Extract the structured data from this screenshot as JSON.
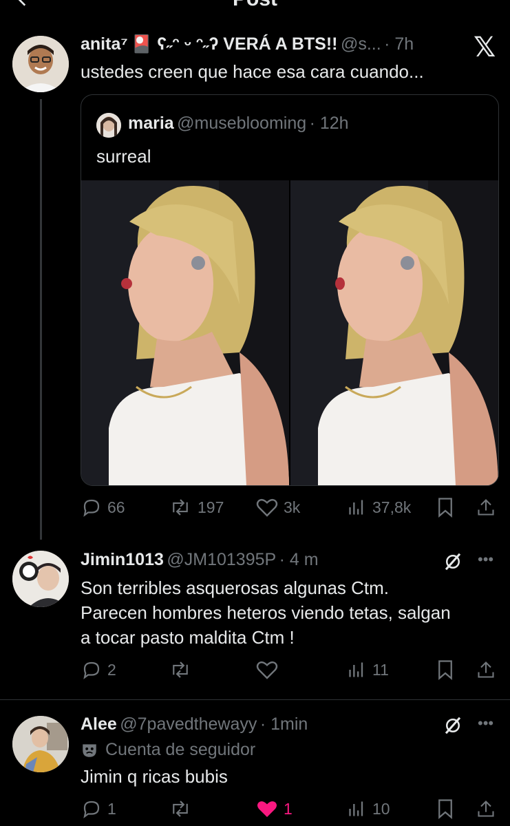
{
  "header": {
    "title": "Post"
  },
  "main_post": {
    "author_name": "anita⁷",
    "author_badges": "🎴 ʕ˶ᵔ ᵕ ᵔ˶ʔ VERÁ A BTS!!",
    "handle": "@s...",
    "time": "· 7h",
    "text": "ustedes creen que hace esa cara cuando...",
    "quote": {
      "author_name": "maria",
      "handle": "@museblooming",
      "time": "· 12h",
      "text": "surreal"
    },
    "stats": {
      "replies": "66",
      "reposts": "197",
      "likes": "3k",
      "views": "37,8k"
    }
  },
  "replies": [
    {
      "author_name": "Jimin1013",
      "handle": "@JM101395P",
      "time": "· 4 m",
      "text_lines": [
        "Son terribles asquerosas algunas Ctm.",
        "Parecen hombres heteros viendo tetas, salgan",
        "a tocar pasto maldita Ctm !"
      ],
      "stats": {
        "replies": "2",
        "reposts": "",
        "likes": "",
        "views": "11"
      }
    },
    {
      "author_name": "Alee",
      "handle": "@7pavedthewayy",
      "time": "· 1min",
      "follower_label": "Cuenta de seguidor",
      "text": "Jimin q ricas bubis",
      "stats": {
        "replies": "1",
        "reposts": "",
        "likes": "1",
        "views": "10"
      }
    }
  ],
  "colors": {
    "background": "#000000",
    "text": "#e7e9ea",
    "secondary": "#71767b",
    "like": "#f91880"
  }
}
